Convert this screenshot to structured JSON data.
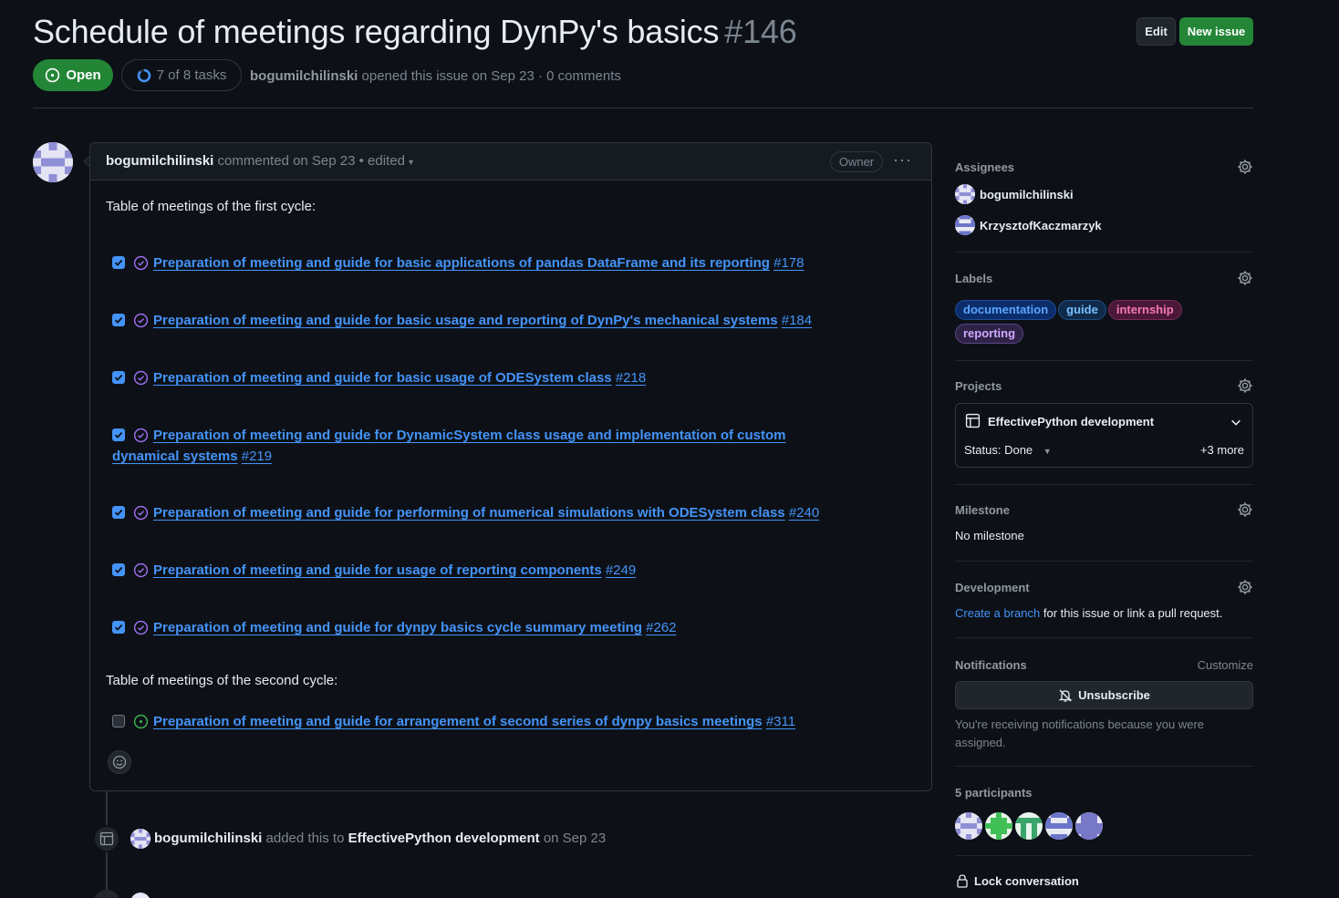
{
  "issue": {
    "title": "Schedule of meetings regarding DynPy's basics",
    "number": "#146",
    "state": "Open",
    "tasks": "7 of 8 tasks",
    "author": "bogumilchilinski",
    "meta_rest": "opened this issue on Sep 23 · 0 comments",
    "buttons": {
      "edit": "Edit",
      "new": "New issue"
    }
  },
  "comment": {
    "author": "bogumilchilinski",
    "header_rest": "commented on Sep 23 • edited",
    "owner_badge": "Owner",
    "first_cycle_heading": "Table of meetings of the first cycle:",
    "second_cycle_heading": "Table of meetings of the second cycle:",
    "tasks": [
      {
        "text": "Preparation of meeting and guide for basic applications of pandas DataFrame and its reporting",
        "ref": "#178",
        "checked": true
      },
      {
        "text": "Preparation of meeting and guide for basic usage and reporting of DynPy's mechanical systems",
        "ref": "#184",
        "checked": true
      },
      {
        "text": "Preparation of meeting and guide for basic usage of ODESystem class",
        "ref": "#218",
        "checked": true
      },
      {
        "text": "Preparation of meeting and guide for DynamicSystem class usage and implementation of custom dynamical systems",
        "ref": "#219",
        "checked": true
      },
      {
        "text": "Preparation of meeting and guide for performing of numerical simulations with ODESystem class",
        "ref": "#240",
        "checked": true
      },
      {
        "text": "Preparation of meeting and guide for usage of reporting components",
        "ref": "#249",
        "checked": true
      },
      {
        "text": "Preparation of meeting and guide for dynpy basics cycle summary meeting",
        "ref": "#262",
        "checked": true
      },
      {
        "text": "Preparation of meeting and guide for arrangement of second series of dynpy basics meetings",
        "ref": "#311",
        "checked": false
      }
    ]
  },
  "timeline": {
    "actor": "bogumilchilinski",
    "action": "added this to",
    "project": "EffectivePython development",
    "date": "on Sep 23"
  },
  "sidebar": {
    "assignees": {
      "heading": "Assignees",
      "people": [
        "bogumilchilinski",
        "KrzysztofKaczmarzyk"
      ]
    },
    "labels": {
      "heading": "Labels",
      "items": [
        {
          "name": "documentation",
          "color": "#58a6ff"
        },
        {
          "name": "guide",
          "color": "#79c0ff"
        },
        {
          "name": "internship",
          "color": "#f778ba"
        },
        {
          "name": "reporting",
          "color": "#d2a8ff"
        }
      ]
    },
    "projects": {
      "heading": "Projects",
      "name": "EffectivePython development",
      "status": "Status: Done",
      "more": "+3 more"
    },
    "milestone": {
      "heading": "Milestone",
      "value": "No milestone"
    },
    "development": {
      "heading": "Development",
      "link": "Create a branch",
      "rest": " for this issue or link a pull request."
    },
    "notifications": {
      "heading": "Notifications",
      "customize": "Customize",
      "button": "Unsubscribe",
      "note": "You're receiving notifications because you were assigned."
    },
    "participants": {
      "heading": "5 participants"
    },
    "lock": "Lock conversation"
  },
  "colors": {
    "bg": "#0d1117",
    "accent_green": "#238636",
    "link": "#4493f8",
    "border": "#30363d"
  }
}
